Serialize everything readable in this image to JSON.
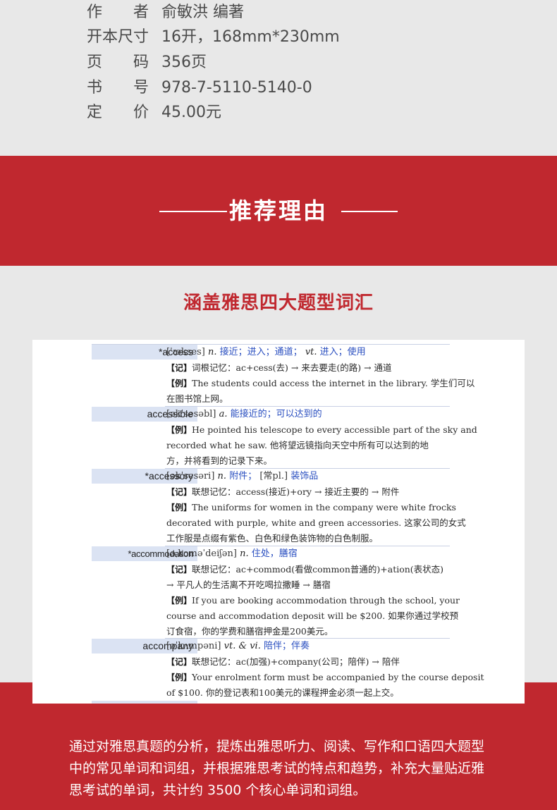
{
  "info": {
    "rows": [
      {
        "label": "作者",
        "value": "俞敏洪 编著"
      },
      {
        "label": "开本尺寸",
        "value": "16开，168mm*230mm"
      },
      {
        "label": "页码",
        "value": "356页"
      },
      {
        "label": "书号",
        "value": "978-7-5110-5140-0"
      },
      {
        "label": "定价",
        "value": "45.00元"
      }
    ],
    "label_chars": [
      [
        "作",
        "者"
      ],
      [
        "页",
        "码"
      ],
      [
        "书",
        "号"
      ],
      [
        "定",
        "价"
      ]
    ]
  },
  "banner": {
    "title": "推荐理由"
  },
  "subtitle": "涵盖雅思四大题型词汇",
  "dictionary": {
    "entries": [
      {
        "headword": "*access",
        "phonetic": "[ˈækses]",
        "pos": "n.",
        "meaning": "接近；进入；通道；",
        "pos2": "vt.",
        "meaning2": "进入；使用",
        "lines": [
          {
            "tag": "【记】",
            "text": "词根记忆：ac+cess(去) → 来去要走(的路) → 通道"
          },
          {
            "tag": "【例】",
            "text": "The students could access the internet in the library. 学生们可以"
          },
          {
            "tag": "",
            "text": "在图书馆上网。"
          }
        ]
      },
      {
        "headword": "accessible",
        "phonetic": "[əkˈsesəbl]",
        "pos": "a.",
        "meaning": "能接近的；可以达到的",
        "lines": [
          {
            "tag": "【例】",
            "text": "He pointed his telescope to every accessible part of the sky and"
          },
          {
            "tag": "",
            "text": "recorded what he saw. 他将望远镜指向天空中所有可以达到的地"
          },
          {
            "tag": "",
            "text": "方，并将看到的记录下来。"
          }
        ]
      },
      {
        "headword": "*accessory",
        "phonetic": "[əkˈsesəri]",
        "pos": "n.",
        "meaning": "附件；",
        "extra": "[常pl.]",
        "meaning2": "装饰品",
        "lines": [
          {
            "tag": "【记】",
            "text": "联想记忆：access(接近)+ory → 接近主要的 → 附件"
          },
          {
            "tag": "【例】",
            "text": "The uniforms for women in the company were white frocks"
          },
          {
            "tag": "",
            "text": "decorated with purple, white and green accessories. 这家公司的女式"
          },
          {
            "tag": "",
            "text": "工作服是点缀有紫色、白色和绿色装饰物的白色制服。"
          }
        ]
      },
      {
        "headword": "*accommodation",
        "phonetic": "[əˌkɔməˈdeiʃən]",
        "pos": "n.",
        "meaning": "住处，膳宿",
        "lines": [
          {
            "tag": "【记】",
            "text": "联想记忆：ac+commod(看做common普通的)+ation(表状态)"
          },
          {
            "tag": "",
            "text": "→ 平凡人的生活离不开吃喝拉撒睡 → 膳宿"
          },
          {
            "tag": "【例】",
            "text": "If you are booking accommodation through the school, your"
          },
          {
            "tag": "",
            "text": "course and accommodation deposit will be $200. 如果你通过学校预"
          },
          {
            "tag": "",
            "text": "订食宿，你的学费和膳宿押金是200美元。"
          }
        ]
      },
      {
        "headword": "accompany",
        "phonetic": "[əˈkʌmpəni]",
        "pos": "vt. & vi.",
        "meaning": "陪伴；伴奏",
        "lines": [
          {
            "tag": "【记】",
            "text": "联想记忆：ac(加强)+company(公司；陪伴) → 陪伴"
          },
          {
            "tag": "【例】",
            "text": "Your enrolment form must be accompanied by the course deposit"
          },
          {
            "tag": "",
            "text": "of $100. 你的登记表和100美元的课程押金必须一起上交。"
          }
        ]
      }
    ]
  },
  "description": "通过对雅思真题的分析，提炼出雅思听力、阅读、写作和口语四大题型中的常见单词和词组，并根据雅思考试的特点和趋势，补充大量贴近雅思考试的单词，共计约 3500 个核心单词和词组。",
  "colors": {
    "accent": "#c0282f",
    "background": "#e8e8e8",
    "headword_bg": "#dbe3f3",
    "meaning": "#2a4fc0"
  }
}
